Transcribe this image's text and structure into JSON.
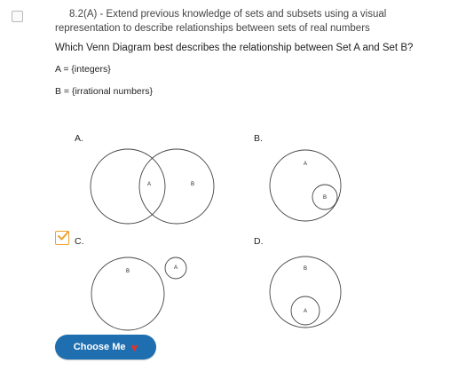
{
  "standard": {
    "line1": "8.2(A) - Extend previous knowledge of sets and subsets using a visual",
    "line2": "representation to describe relationships between sets of real numbers"
  },
  "question": "Which Venn Diagram best describes the relationship between Set A and Set B?",
  "sets": {
    "a": "A = {integers}",
    "b": "B = {irrational numbers}"
  },
  "options": [
    {
      "label": "A.",
      "circle1": "A",
      "circle2": "B",
      "selected": false
    },
    {
      "label": "B.",
      "outer": "A",
      "inner": "B",
      "selected": false
    },
    {
      "label": "C.",
      "big": "B",
      "small": "A",
      "selected": true
    },
    {
      "label": "D.",
      "outer": "B",
      "inner": "A",
      "selected": false
    }
  ],
  "button": {
    "label": "Choose Me"
  },
  "colors": {
    "button": "#1f6fb0",
    "heart": "#e0342c",
    "check": "#f0a030"
  }
}
